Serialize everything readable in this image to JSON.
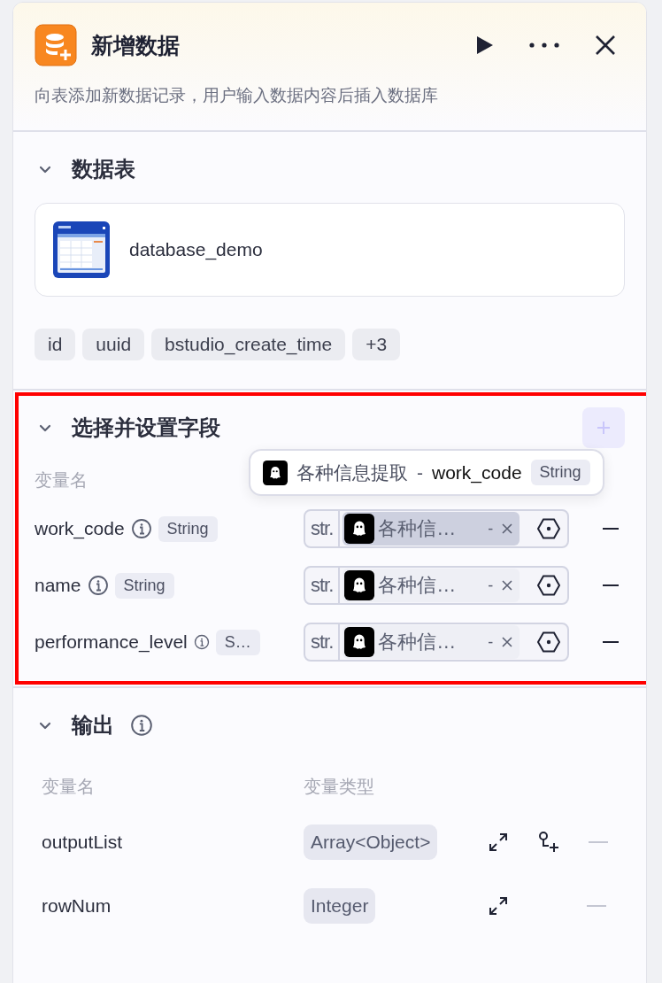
{
  "node": {
    "title": "新增数据",
    "description": "向表添加新数据记录，用户输入数据内容后插入数据库"
  },
  "table_section": {
    "title": "数据表",
    "expanded": true,
    "table_name": "database_demo",
    "fields": [
      "id",
      "uuid",
      "bstudio_create_time",
      "+3"
    ]
  },
  "fields_section": {
    "title": "选择并设置字段",
    "expanded": true,
    "highlighted": true,
    "add_disabled": true,
    "column_header": "变量名",
    "tooltip": {
      "source": "各种信息提取",
      "separator": "-",
      "variable": "work_code",
      "type": "String"
    },
    "rows": [
      {
        "name": "work_code",
        "type": "String",
        "prefix": "str.",
        "source": "各种信…",
        "separator": "-",
        "hovered": true
      },
      {
        "name": "name",
        "type": "String",
        "prefix": "str.",
        "source": "各种信…",
        "separator": "-",
        "hovered": false
      },
      {
        "name": "performance_level",
        "type": "S…",
        "prefix": "str.",
        "source": "各种信…",
        "separator": "-",
        "hovered": false
      }
    ]
  },
  "output_section": {
    "title": "输出",
    "expanded": true,
    "columns": [
      "变量名",
      "变量类型"
    ],
    "rows": [
      {
        "name": "outputList",
        "type": "Array<Object>",
        "can_add_child": true
      },
      {
        "name": "rowNum",
        "type": "Integer",
        "can_add_child": false
      }
    ]
  }
}
